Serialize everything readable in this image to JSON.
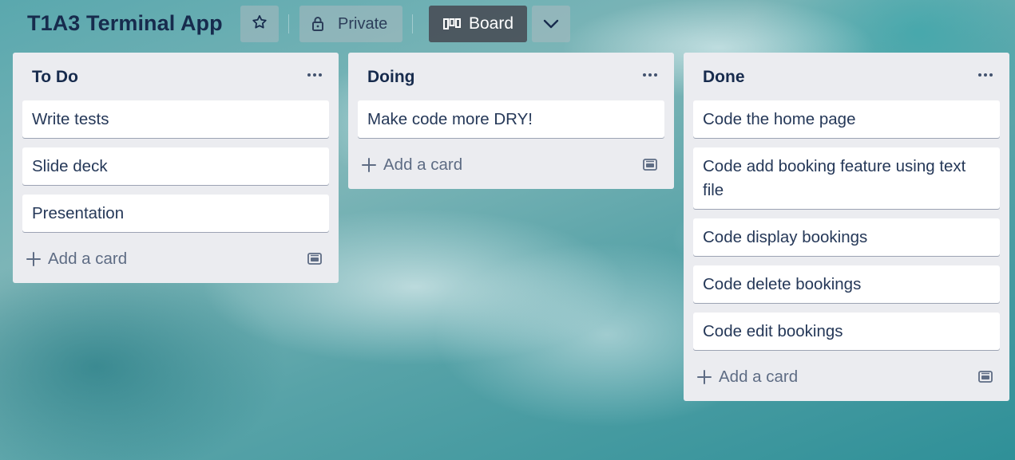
{
  "board": {
    "title": "T1A3 Terminal App",
    "visibility_label": "Private",
    "view_label": "Board",
    "icons": {
      "star": "star-icon",
      "lock": "lock-icon",
      "board": "board-view-icon",
      "chevron": "chevron-down-icon"
    }
  },
  "lists": [
    {
      "title": "To Do",
      "cards": [
        "Write tests",
        "Slide deck",
        "Presentation"
      ],
      "add_label": "Add a card"
    },
    {
      "title": "Doing",
      "cards": [
        "Make code more DRY!"
      ],
      "add_label": "Add a card"
    },
    {
      "title": "Done",
      "cards": [
        "Code the home page",
        "Code add booking feature using text file",
        "Code display bookings",
        "Code delete bookings",
        "Code edit bookings"
      ],
      "add_label": "Add a card"
    }
  ],
  "colors": {
    "list_bg": "#ebecf0",
    "card_bg": "#ffffff",
    "text": "#172b4d",
    "muted": "#5e6c84",
    "board_button_bg": "#484e56"
  }
}
